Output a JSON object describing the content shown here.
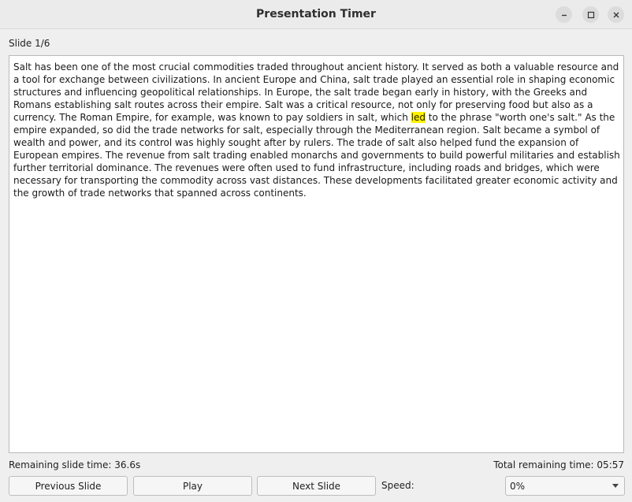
{
  "window": {
    "title": "Presentation Timer"
  },
  "slide": {
    "label": "Slide 1/6",
    "text_before": "Salt has been one of the most crucial commodities traded throughout ancient history. It served as both a valuable resource and a tool for exchange between civilizations. In ancient Europe and China, salt trade played an essential role in shaping economic structures and influencing geopolitical relationships. In Europe, the salt trade began early in history, with the Greeks and Romans establishing salt routes across their empire. Salt was a critical resource, not only for preserving food but also as a currency. The Roman Empire, for example, was known to pay soldiers in salt, which ",
    "highlighted_word": "led",
    "text_after": " to the phrase \"worth one's salt.\" As the empire expanded, so did the trade networks for salt, especially through the Mediterranean region. Salt became a symbol of wealth and power, and its control was highly sought after by rulers. The trade of salt also helped fund the expansion of European empires. The revenue from salt trading enabled monarchs and governments to build powerful militaries and establish further territorial dominance. The revenues were often used to fund infrastructure, including roads and bridges, which were necessary for transporting the commodity across vast distances. These developments facilitated greater economic activity and the growth of trade networks that spanned across continents."
  },
  "status": {
    "remaining_slide_time": "Remaining slide time: 36.6s",
    "total_remaining_time": "Total remaining time: 05:57"
  },
  "controls": {
    "previous_label": "Previous Slide",
    "play_label": "Play",
    "next_label": "Next Slide",
    "speed_label": "Speed:",
    "speed_value": "0%"
  },
  "colors": {
    "highlight": "#fff200",
    "window_bg": "#efefef"
  },
  "icons": {
    "minimize": "minimize-icon",
    "maximize": "maximize-icon",
    "close": "close-icon",
    "dropdown": "chevron-down-icon"
  }
}
